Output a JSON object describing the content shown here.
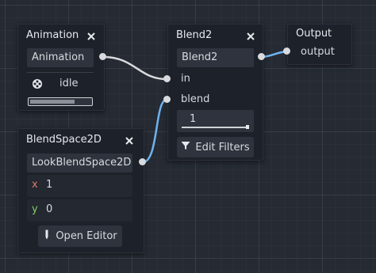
{
  "nodes": {
    "animation": {
      "title": "Animation",
      "selector_value": "Animation",
      "animation_name": "idle"
    },
    "blend2": {
      "title": "Blend2",
      "name_value": "Blend2",
      "port_in": "in",
      "port_blend": "blend",
      "blend_amount": "1",
      "edit_filters_label": "Edit Filters"
    },
    "output": {
      "title": "Output",
      "port_output": "output"
    },
    "blendspace": {
      "title": "BlendSpace2D",
      "name_value": "LookBlendSpace2D",
      "x_label": "x",
      "x_value": "1",
      "y_label": "y",
      "y_value": "0",
      "open_editor_label": "Open Editor"
    }
  },
  "colors": {
    "wire_animation": "#d8dadd",
    "wire_blendspace": "#6fb3ee",
    "wire_output": "#6fb3ee",
    "x_axis": "#e0776a",
    "y_axis": "#7fcf6a"
  },
  "icons": {
    "close": "close-icon",
    "animation": "film-reel-icon",
    "filter": "filter-icon",
    "editor": "pencil-icon"
  },
  "blend_amount_fraction": 1.0
}
